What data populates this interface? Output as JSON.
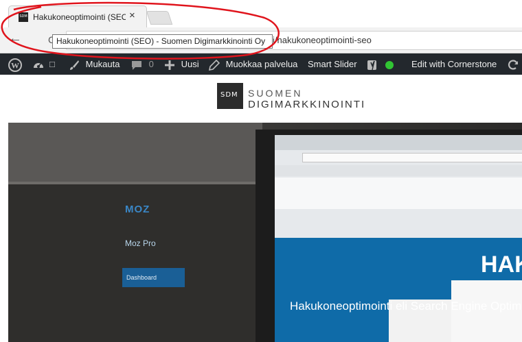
{
  "browser": {
    "tab": {
      "favicon_text": "SDM",
      "title": "Hakukoneoptimointi (SEO",
      "close_glyph": "×"
    },
    "tooltip": "Hakukoneoptimointi (SEO) - Suomen Digimarkkinointi Oy",
    "nav": {
      "back_glyph": "←",
      "reload_fragment": "C"
    },
    "url": "i/hakukoneoptimointi-seo"
  },
  "admin_bar": {
    "items": {
      "wordpress_icon": "wordpress-icon",
      "dashboard_icon": "dashboard-icon",
      "small_box": "□",
      "customize": "Mukauta",
      "comments_count": "0",
      "new": "Uusi",
      "edit_service": "Muokkaa palvelua",
      "smart_slider": "Smart Slider",
      "cornerstone": "Edit with Cornerstone"
    },
    "status_color": "#31c433"
  },
  "site": {
    "logo_mark": "SDM",
    "logo_line1": "SUOMEN",
    "logo_line2": "DIGIMARKKINOINTI"
  },
  "hero": {
    "title": "HAK",
    "subtitle": "Hakukoneoptimointi eli Search Engine Optim",
    "screen": {
      "logo": "MOZ",
      "product": "Moz Pro",
      "dashboard": "Dashboard"
    }
  },
  "annotation_color": "#e0141c"
}
